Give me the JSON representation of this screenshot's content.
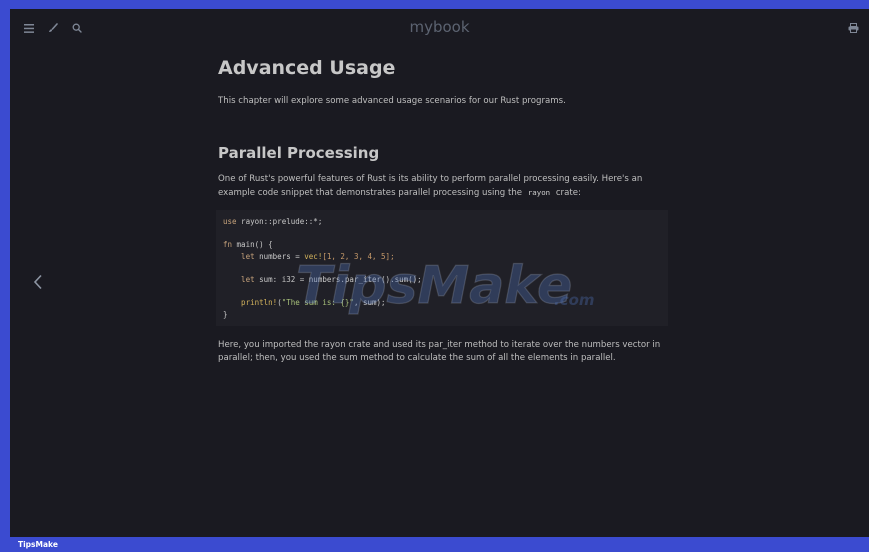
{
  "topbar": {
    "title": "mybook",
    "menu_icon": "hamburger-menu-icon",
    "theme_icon": "paintbrush-icon",
    "search_icon": "search-icon",
    "print_icon": "printer-icon"
  },
  "content": {
    "h1": "Advanced Usage",
    "intro": "This chapter will explore some advanced usage scenarios for our Rust programs.",
    "h2": "Parallel Processing",
    "p2_before": "One of Rust's powerful features of Rust is its ability to perform parallel processing easily. Here's an example code snippet that demonstrates parallel processing using the",
    "p2_code": "rayon",
    "p2_after": "crate:",
    "code": {
      "line1_kw": "use",
      "line1_rest": " rayon::prelude::*;",
      "line3_kw": "fn",
      "line3_rest": " main() {",
      "line4_kw": "    let",
      "line4_a": " numbers = ",
      "line4_mac": "vec!",
      "line4_b": "[1, 2, 3, 4, 5];",
      "line6_kw": "    let",
      "line6_a": " sum: ",
      "line6_ty": "i32",
      "line6_b": " = numbers.par_iter().sum();",
      "line8_mac": "    println!",
      "line8_a": "(",
      "line8_str": "\"The sum is: {}\"",
      "line8_b": ", sum);",
      "line9": "}"
    },
    "p3": "Here, you imported the rayon crate and used its par_iter method to iterate over the numbers vector in parallel; then, you used the sum method to calculate the sum of all the elements in parallel."
  },
  "watermark": {
    "text_main": "TipsMake",
    "text_suffix": ".com"
  },
  "footer": {
    "brand": "TipsMake"
  },
  "colors": {
    "frame_bg": "#1a1a21",
    "border_blue": "#3b4bd0",
    "code_bg": "#202027"
  }
}
